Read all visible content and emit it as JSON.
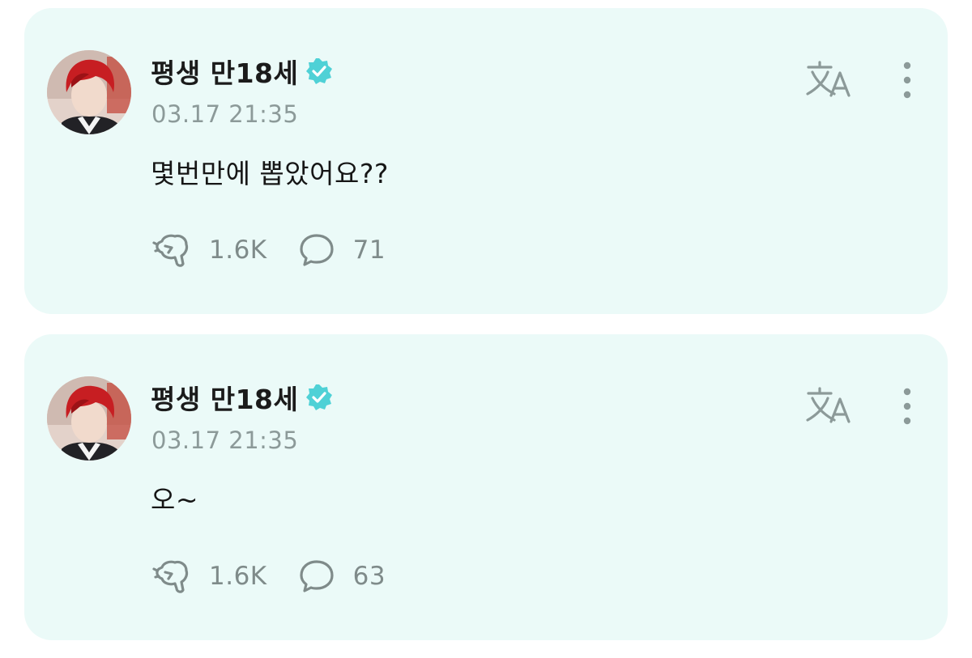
{
  "posts": [
    {
      "author": "평생 만18세",
      "verified": true,
      "time": "03.17 21:35",
      "text": "몇번만에 뽑았어요??",
      "likes": "1.6K",
      "comments": "71"
    },
    {
      "author": "평생 만18세",
      "verified": true,
      "time": "03.17 21:35",
      "text": "오~",
      "likes": "1.6K",
      "comments": "63"
    }
  ],
  "icons": {
    "translate": "translate-icon",
    "more": "more-vertical-icon",
    "like": "cheer-icon",
    "comment": "comment-icon",
    "verified": "verified-badge-icon"
  },
  "colors": {
    "card_background": "#ebfaf8",
    "verified_badge": "#4fd1d6",
    "icon_gray": "#7f8b8a",
    "secondary_text": "#8c9a99"
  }
}
